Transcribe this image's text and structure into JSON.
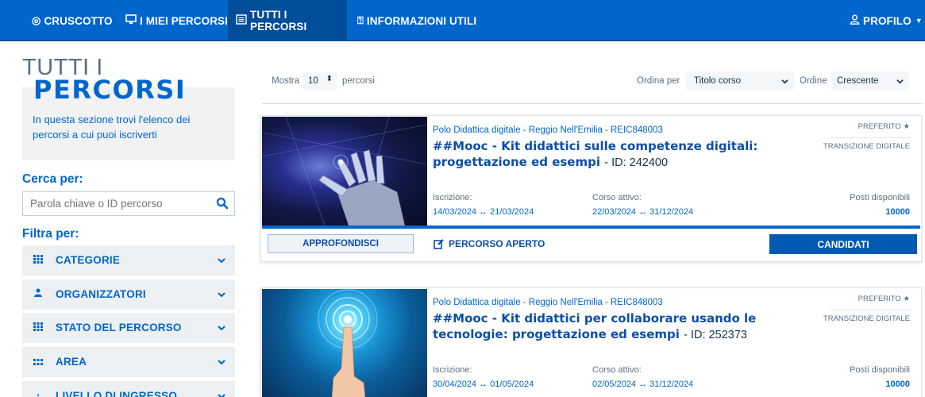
{
  "nav": {
    "items": [
      {
        "icon": "target-icon",
        "label": "CRUSCOTTO"
      },
      {
        "icon": "monitor-icon",
        "label": "I MIEI PERCORSI"
      },
      {
        "icon": "list-icon",
        "label": "TUTTI I PERCORSI"
      },
      {
        "icon": "help-circle-icon",
        "label": "INFORMAZIONI UTILI"
      }
    ],
    "profile_label": "PROFILO",
    "active_index": 2,
    "bg_color": "#0066cc"
  },
  "sidebar": {
    "title_line1": "TUTTI I",
    "title_line2": "PERCORSI",
    "intro": "In questa sezione trovi l'elenco dei percorsi a cui puoi iscriverti",
    "search_label": "Cerca per:",
    "search_placeholder": "Parola chiave o ID percorso",
    "filter_label": "Filtra per:",
    "filters": [
      {
        "icon": "grid-icon",
        "label": "CATEGORIE"
      },
      {
        "icon": "users-icon",
        "label": "ORGANIZZATORI"
      },
      {
        "icon": "grid-icon",
        "label": "STATO DEL PERCORSO"
      },
      {
        "icon": "dots-icon",
        "label": "AREA"
      },
      {
        "icon": "arrow-up-icon",
        "label": "LIVELLO DI INGRESSO"
      }
    ]
  },
  "toolbar": {
    "show_label": "Mostra",
    "show_value": "10",
    "show_suffix": "percorsi",
    "sort_label": "Ordina per",
    "sort_value": "Titolo corso",
    "order_label": "Ordine",
    "order_value": "Crescente"
  },
  "courses": [
    {
      "organizer": "Polo Didattica digitale - Reggio Nell'Emilia - REIC848003",
      "title": "##Mooc - Kit didattici sulle competenze digitali: progettazione ed esempi",
      "id_text": "- ID: 242400",
      "favorite": "PREFERITO",
      "tag": "TRANSIZIONE DIGITALE",
      "enroll_label": "Iscrizione:",
      "enroll_dates": "14/03/2024 ↔ 21/03/2024",
      "active_label": "Corso attivo:",
      "active_dates": "22/03/2024 ↔ 31/12/2024",
      "seats_label": "Posti disponibili",
      "seats": "10000",
      "details_btn": "APPROFONDISCI",
      "status": "PERCORSO APERTO",
      "apply_btn": "CANDIDATI",
      "image": "robot-hand-image"
    },
    {
      "organizer": "Polo Didattica digitale - Reggio Nell'Emilia - REIC848003",
      "title": "##Mooc - Kit didattici per collaborare usando le tecnologie: progettazione ed esempi",
      "id_text": "- ID: 252373",
      "favorite": "PREFERITO",
      "tag": "TRANSIZIONE DIGITALE",
      "enroll_label": "Iscrizione:",
      "enroll_dates": "30/04/2024 ↔ 01/05/2024",
      "active_label": "Corso attivo:",
      "active_dates": "02/05/2024 ↔ 31/12/2024",
      "seats_label": "Posti disponibili",
      "seats": "10000",
      "image": "finger-touch-image"
    }
  ]
}
